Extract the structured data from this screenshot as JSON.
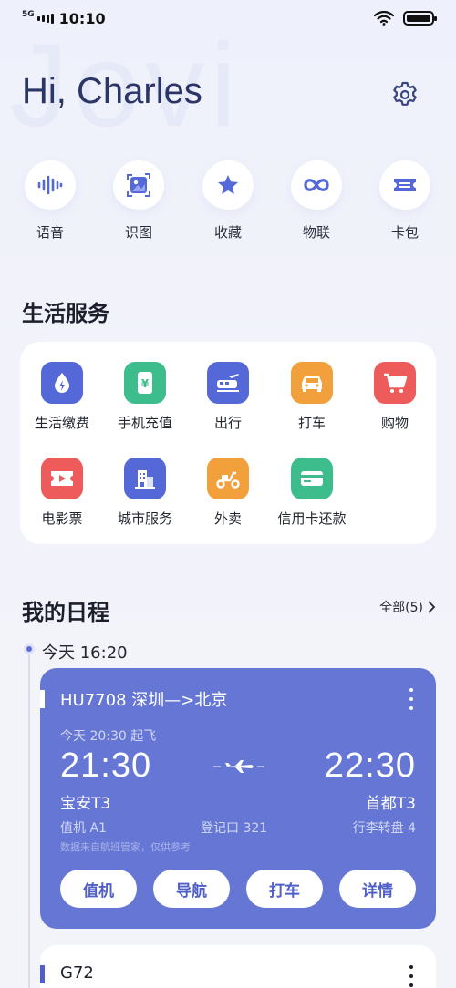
{
  "status_bar": {
    "network": "5G",
    "time": "10:10"
  },
  "watermark": "Jovi",
  "header": {
    "greeting": "Hi, Charles"
  },
  "quick_actions": [
    {
      "label": "语音",
      "icon": "voice-wave-icon"
    },
    {
      "label": "识图",
      "icon": "image-scan-icon"
    },
    {
      "label": "收藏",
      "icon": "star-icon"
    },
    {
      "label": "物联",
      "icon": "infinity-icon"
    },
    {
      "label": "卡包",
      "icon": "ticket-icon"
    }
  ],
  "life_services": {
    "title": "生活服务",
    "items": [
      {
        "label": "生活缴费",
        "icon": "water-drop-icon",
        "color": "#5468d8"
      },
      {
        "label": "手机充值",
        "icon": "phone-yen-icon",
        "color": "#3dbd8b"
      },
      {
        "label": "出行",
        "icon": "train-plane-icon",
        "color": "#5468d8"
      },
      {
        "label": "打车",
        "icon": "car-icon",
        "color": "#f2a03c"
      },
      {
        "label": "购物",
        "icon": "cart-icon",
        "color": "#ee5b5b"
      },
      {
        "label": "电影票",
        "icon": "movie-ticket-icon",
        "color": "#ee5b5b"
      },
      {
        "label": "城市服务",
        "icon": "building-icon",
        "color": "#5468d8"
      },
      {
        "label": "外卖",
        "icon": "scooter-icon",
        "color": "#f2a03c"
      },
      {
        "label": "信用卡还款",
        "icon": "credit-card-icon",
        "color": "#3dbd8b"
      }
    ]
  },
  "schedule": {
    "title": "我的日程",
    "all_label": "全部(5)",
    "time_label": "今天 16:20",
    "flight": {
      "title": "HU7708 深圳—>北京",
      "depart_note": "今天 20:30 起飞",
      "depart_time": "21:30",
      "arrive_time": "22:30",
      "depart_airport": "宝安T3",
      "arrive_airport": "首都T3",
      "checkin_counter": "值机 A1",
      "gate": "登记口 321",
      "baggage": "行李转盘 4",
      "disclaimer": "数据来自航班管家，仅供参考",
      "actions": [
        "值机",
        "导航",
        "打车",
        "详情"
      ]
    },
    "train": {
      "title": "G72"
    }
  },
  "colors": {
    "accent": "#6576d5",
    "title": "#2b3566"
  }
}
